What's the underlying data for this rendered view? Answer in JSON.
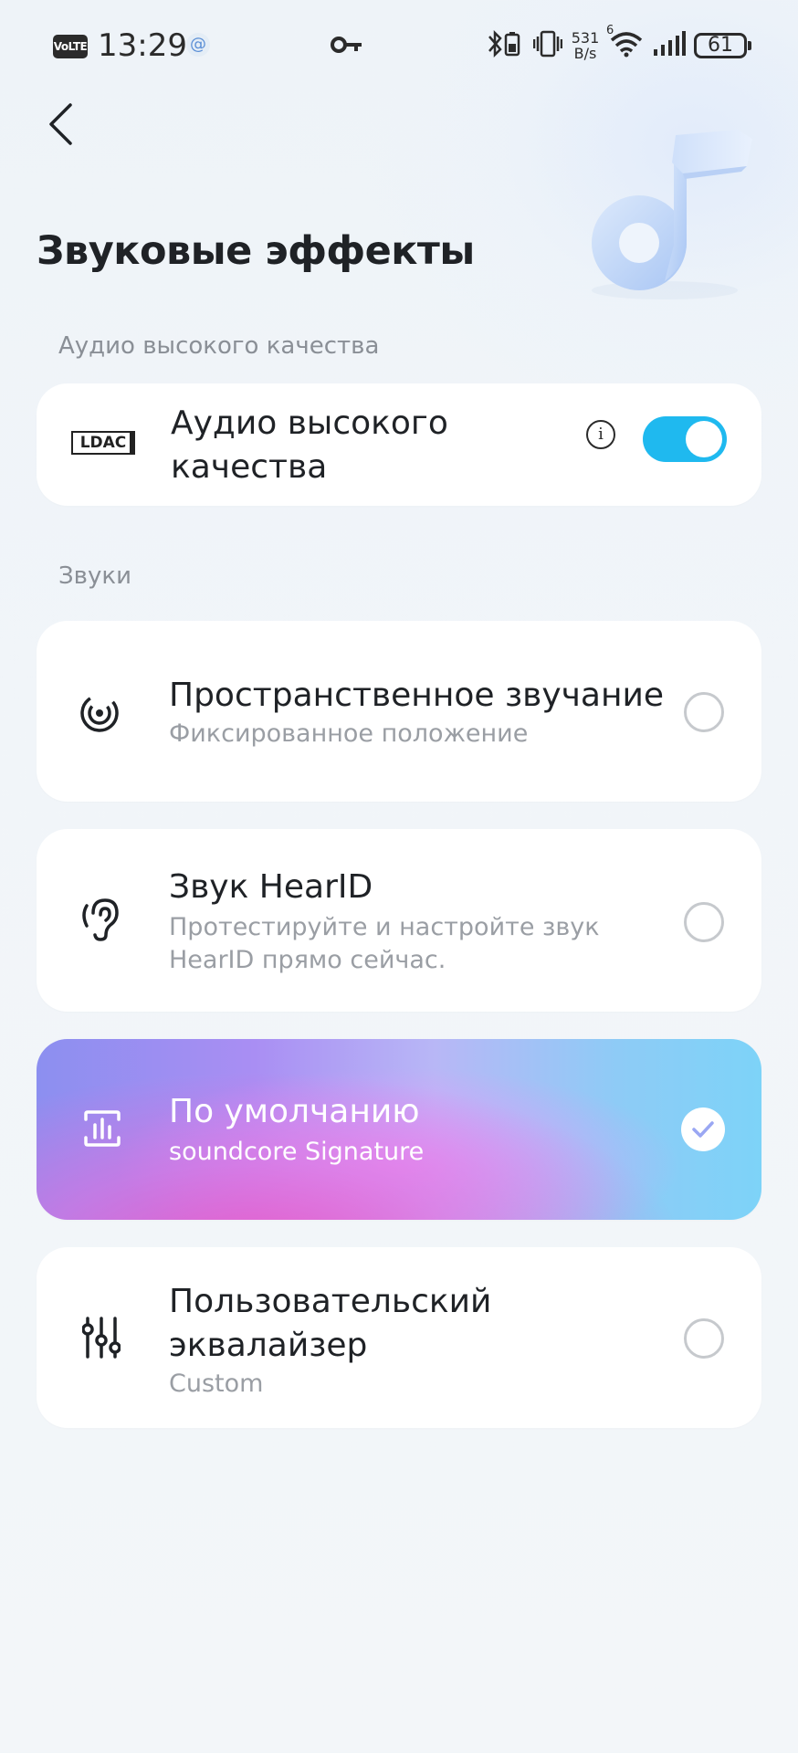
{
  "status_bar": {
    "volte": "VoLTE",
    "time": "13:29",
    "at_symbol": "@",
    "speed_value": "531",
    "speed_unit": "B/s",
    "wifi_label": "6",
    "battery": "61"
  },
  "header": {
    "title": "Звуковые эффекты"
  },
  "sections": {
    "hq_label": "Аудио высокого качества",
    "sounds_label": "Звуки"
  },
  "hq_card": {
    "badge": "LDAC",
    "title_line1": "Аудио высокого",
    "title_line2": "качества",
    "info_glyph": "i",
    "toggle_on": true
  },
  "sound_options": [
    {
      "icon": "spatial-audio-icon",
      "title": "Пространственное звучание",
      "subtitle": "Фиксированное положение",
      "selected": false
    },
    {
      "icon": "ear-icon",
      "title": "Звук HearID",
      "subtitle_line1": "Протестируйте и настройте звук",
      "subtitle_line2": "HearID прямо сейчас.",
      "selected": false
    },
    {
      "icon": "equalizer-preset-icon",
      "title": "По умолчанию",
      "subtitle": "soundcore Signature",
      "selected": true
    },
    {
      "icon": "sliders-icon",
      "title_line1": "Пользовательский",
      "title_line2": "эквалайзер",
      "subtitle": "Custom",
      "selected": false
    }
  ],
  "colors": {
    "accent": "#1fb9ef",
    "background": "#f1f5f9",
    "card": "#ffffff",
    "text_primary": "#1f2226",
    "text_secondary": "#9a9ea4"
  }
}
